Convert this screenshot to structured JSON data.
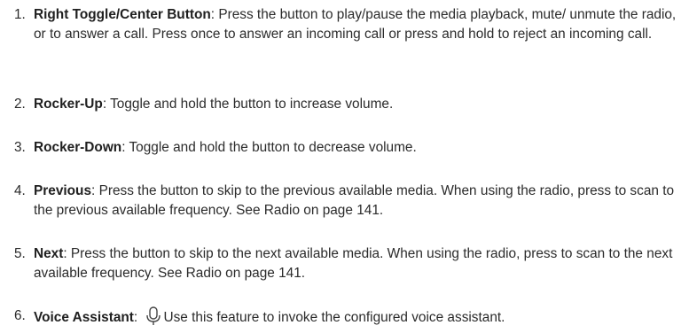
{
  "items": [
    {
      "number": "1.",
      "term": "Right Toggle/Center Button",
      "desc": ": Press the button to play/pause the media playback, mute/ unmute the radio, or to answer a call. Press once to answer an incoming call or press and hold to reject an incoming call."
    },
    {
      "number": "2.",
      "term": "Rocker-Up",
      "desc": ": Toggle and hold the button to increase volume."
    },
    {
      "number": "3.",
      "term": "Rocker-Down",
      "desc": ": Toggle and hold the button to decrease volume."
    },
    {
      "number": "4.",
      "term": "Previous",
      "desc": ": Press the button to skip to the previous available media. When using the radio, press to scan to the previous available frequency. See Radio on page 141."
    },
    {
      "number": "5.",
      "term": "Next",
      "desc": ": Press the button to skip to the next available media. When using the radio, press to scan to the next available frequency. See Radio on page 141."
    },
    {
      "number": "6.",
      "term": "Voice Assistant",
      "desc_after_icon": "Use this feature to invoke the configured voice assistant.",
      "icon": "microphone-icon"
    }
  ]
}
